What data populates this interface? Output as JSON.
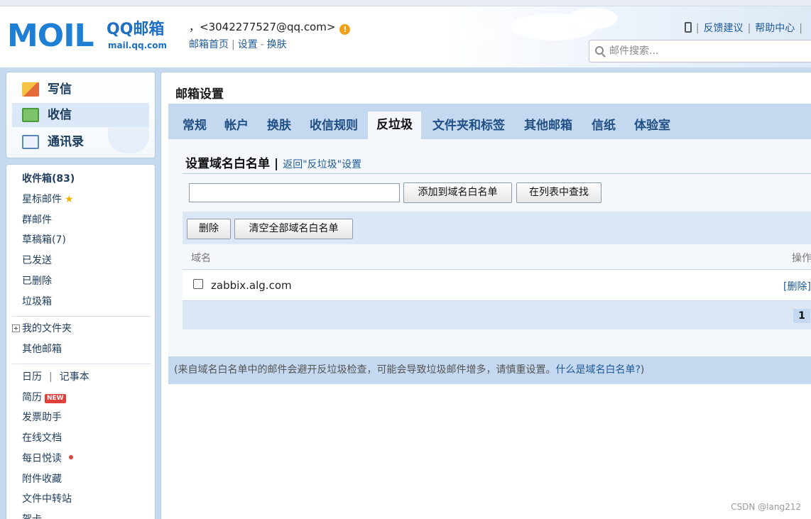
{
  "header": {
    "logo_text": "MOIL",
    "logo_brand": "QQ邮箱",
    "logo_url": "mail.qq.com",
    "user_email": "，<3042277527@qq.com>",
    "warning_glyph": "!",
    "links": [
      "邮箱首页",
      "设置",
      "换肤"
    ],
    "separators": [
      "|",
      "-"
    ],
    "right_links": [
      "反馈建议",
      "帮助中心"
    ],
    "search_placeholder": "邮件搜索..."
  },
  "compose_panel": {
    "items": [
      {
        "label": "写信"
      },
      {
        "label": "收信"
      },
      {
        "label": "通讯录"
      }
    ]
  },
  "nav": {
    "inbox": "收件箱(83)",
    "starred": "星标邮件",
    "group": "群邮件",
    "drafts": "草稿箱(7)",
    "sent": "已发送",
    "deleted": "已删除",
    "junk": "垃圾箱",
    "my_folders": "我的文件夹",
    "other_mailboxes": "其他邮箱",
    "calendar": "日历",
    "notes": "记事本",
    "resume": "简历",
    "resume_badge": "NEW",
    "invoice": "发票助手",
    "online_docs": "在线文档",
    "daily_reading": "每日悦读",
    "attachments": "附件收藏",
    "file_transfer": "文件中转站",
    "card": "贺卡",
    "pipe": "|"
  },
  "main": {
    "title": "邮箱设置",
    "tabs": [
      "常规",
      "帐户",
      "换肤",
      "收信规则",
      "反垃圾",
      "文件夹和标签",
      "其他邮箱",
      "信纸",
      "体验室"
    ],
    "active_tab": "反垃圾",
    "section_title": "设置域名白名单",
    "section_sep": "|",
    "back_link": "返回\"反垃圾\"设置",
    "domain_input_value": "",
    "add_button": "添加到域名白名单",
    "find_button": "在列表中查找",
    "delete_button": "删除",
    "clear_button": "清空全部域名白名单",
    "col_domain": "域名",
    "col_action": "操作",
    "rows": [
      {
        "domain": "zabbix.alg.com",
        "action": "[删除]"
      }
    ],
    "page": "1",
    "note": "(来自域名白名单中的邮件会避开反垃圾检查，可能会导致垃圾邮件增多，请慎重设置。",
    "note_link": "什么是域名白名单?",
    "note_end": ")"
  },
  "watermark": "CSDN @lang212",
  "colors": {
    "brand_blue": "#1f7fd4",
    "tab_bar": "#c4d8ef",
    "panel_bg": "#f4f8fd",
    "link": "#1e5a9a",
    "badge_red": "#e0403a",
    "warning": "#f0a017"
  }
}
